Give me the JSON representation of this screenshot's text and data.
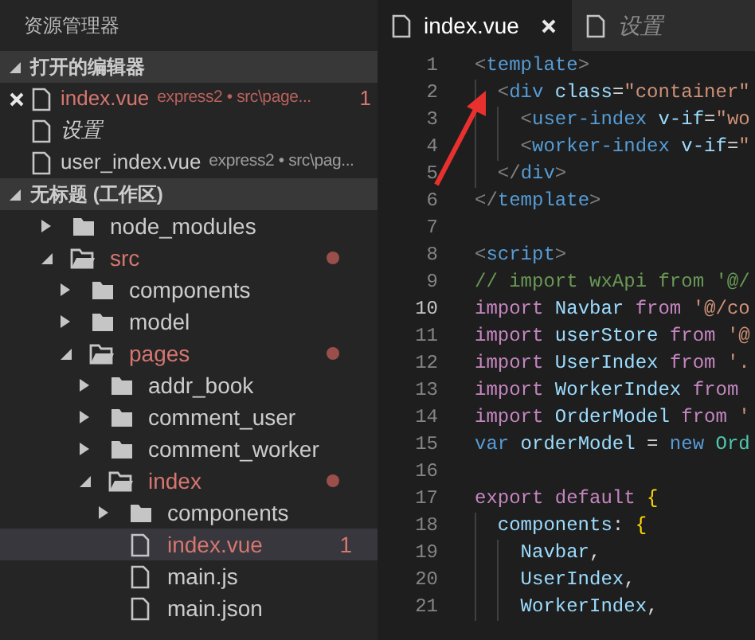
{
  "sidebar": {
    "title": "资源管理器",
    "open_editors": {
      "title": "打开的编辑器",
      "expanded": true,
      "items": [
        {
          "name": "index.vue",
          "description": "express2 • src\\page...",
          "badge": "1",
          "modified": true,
          "italic": false,
          "closable": true
        },
        {
          "name": "设置",
          "italic": true,
          "modified": false,
          "closable": false
        },
        {
          "name": "user_index.vue",
          "description": "express2 • src\\pag...",
          "modified": false,
          "italic": false,
          "closable": false
        }
      ]
    },
    "workspace": {
      "title": "无标题 (工作区)",
      "expanded": true,
      "tree": [
        {
          "name": "node_modules",
          "kind": "folder",
          "expanded": false,
          "modified": false
        },
        {
          "name": "src",
          "kind": "folder",
          "expanded": true,
          "modified": true,
          "children": [
            {
              "name": "components",
              "kind": "folder",
              "expanded": false,
              "modified": false
            },
            {
              "name": "model",
              "kind": "folder",
              "expanded": false,
              "modified": false
            },
            {
              "name": "pages",
              "kind": "folder",
              "expanded": true,
              "modified": true,
              "children": [
                {
                  "name": "addr_book",
                  "kind": "folder",
                  "expanded": false,
                  "modified": false
                },
                {
                  "name": "comment_user",
                  "kind": "folder",
                  "expanded": false,
                  "modified": false
                },
                {
                  "name": "comment_worker",
                  "kind": "folder",
                  "expanded": false,
                  "modified": false
                },
                {
                  "name": "index",
                  "kind": "folder",
                  "expanded": true,
                  "modified": true,
                  "children": [
                    {
                      "name": "components",
                      "kind": "folder",
                      "expanded": false,
                      "modified": false
                    },
                    {
                      "name": "index.vue",
                      "kind": "file",
                      "modified": true,
                      "selected": true,
                      "badge": "1"
                    },
                    {
                      "name": "main.js",
                      "kind": "file",
                      "modified": false,
                      "selected": false
                    },
                    {
                      "name": "main.json",
                      "kind": "file",
                      "modified": false,
                      "selected": false
                    }
                  ]
                }
              ]
            }
          ]
        }
      ]
    }
  },
  "tabs": [
    {
      "label": "index.vue",
      "selected": true,
      "italic": false
    },
    {
      "label": "设置",
      "selected": false,
      "italic": true
    }
  ],
  "code": [
    {
      "number": "1",
      "current": false,
      "tokens": [
        {
          "t": "<",
          "kind": "punct"
        },
        {
          "t": "template",
          "kind": "tag"
        },
        {
          "t": ">",
          "kind": "punct"
        }
      ]
    },
    {
      "number": "2",
      "current": false,
      "tokens": [
        {
          "t": "  <",
          "kind": "punct"
        },
        {
          "t": "div",
          "kind": "tag"
        },
        {
          "t": " class",
          "kind": "attr"
        },
        {
          "t": "=",
          "kind": "plain"
        },
        {
          "t": "\"container\"",
          "kind": "string"
        }
      ]
    },
    {
      "number": "3",
      "current": false,
      "tokens": [
        {
          "t": "    <",
          "kind": "punct"
        },
        {
          "t": "user-index",
          "kind": "tag"
        },
        {
          "t": " v-if",
          "kind": "attr"
        },
        {
          "t": "=",
          "kind": "plain"
        },
        {
          "t": "\"wo",
          "kind": "string"
        }
      ]
    },
    {
      "number": "4",
      "current": false,
      "tokens": [
        {
          "t": "    <",
          "kind": "punct"
        },
        {
          "t": "worker-index",
          "kind": "tag"
        },
        {
          "t": " v-if",
          "kind": "attr"
        },
        {
          "t": "=",
          "kind": "plain"
        },
        {
          "t": "\"",
          "kind": "string"
        }
      ]
    },
    {
      "number": "5",
      "current": false,
      "tokens": [
        {
          "t": "  </",
          "kind": "punct"
        },
        {
          "t": "div",
          "kind": "tag"
        },
        {
          "t": ">",
          "kind": "punct"
        }
      ]
    },
    {
      "number": "6",
      "current": false,
      "tokens": [
        {
          "t": "</",
          "kind": "punct"
        },
        {
          "t": "template",
          "kind": "tag"
        },
        {
          "t": ">",
          "kind": "punct"
        }
      ]
    },
    {
      "number": "7",
      "current": false
    },
    {
      "number": "8",
      "current": false,
      "tokens": [
        {
          "t": "<",
          "kind": "punct"
        },
        {
          "t": "script",
          "kind": "tag"
        },
        {
          "t": ">",
          "kind": "punct"
        }
      ]
    },
    {
      "number": "9",
      "current": false,
      "tokens": [
        {
          "t": "// import wxApi from '@/",
          "kind": "comment"
        }
      ]
    },
    {
      "number": "10",
      "current": true,
      "tokens": [
        {
          "t": "import",
          "kind": "keyword"
        },
        {
          "t": " Navbar ",
          "kind": "ident"
        },
        {
          "t": "from",
          "kind": "keyword"
        },
        {
          "t": " '@/co",
          "kind": "string"
        }
      ]
    },
    {
      "number": "11",
      "current": false,
      "tokens": [
        {
          "t": "import",
          "kind": "keyword"
        },
        {
          "t": " userStore ",
          "kind": "ident"
        },
        {
          "t": "from",
          "kind": "keyword"
        },
        {
          "t": " '@",
          "kind": "string"
        }
      ]
    },
    {
      "number": "12",
      "current": false,
      "tokens": [
        {
          "t": "import",
          "kind": "keyword"
        },
        {
          "t": " UserIndex ",
          "kind": "ident"
        },
        {
          "t": "from",
          "kind": "keyword"
        },
        {
          "t": " '.",
          "kind": "string"
        }
      ]
    },
    {
      "number": "13",
      "current": false,
      "tokens": [
        {
          "t": "import",
          "kind": "keyword"
        },
        {
          "t": " WorkerIndex ",
          "kind": "ident"
        },
        {
          "t": "from",
          "kind": "keyword"
        }
      ]
    },
    {
      "number": "14",
      "current": false,
      "tokens": [
        {
          "t": "import",
          "kind": "keyword"
        },
        {
          "t": " OrderModel ",
          "kind": "ident"
        },
        {
          "t": "from",
          "kind": "keyword"
        },
        {
          "t": " '",
          "kind": "string"
        }
      ]
    },
    {
      "number": "15",
      "current": false,
      "tokens": [
        {
          "t": "var",
          "kind": "storage"
        },
        {
          "t": " orderModel ",
          "kind": "ident"
        },
        {
          "t": "=",
          "kind": "plain"
        },
        {
          "t": " new",
          "kind": "storage"
        },
        {
          "t": " Ord",
          "kind": "class"
        }
      ]
    },
    {
      "number": "16",
      "current": false
    },
    {
      "number": "17",
      "current": false,
      "tokens": [
        {
          "t": "export default",
          "kind": "keyword"
        },
        {
          "t": " {",
          "kind": "brace"
        }
      ]
    },
    {
      "number": "18",
      "current": false,
      "tokens": [
        {
          "t": "  components",
          "kind": "ident"
        },
        {
          "t": ": ",
          "kind": "plain"
        },
        {
          "t": "{",
          "kind": "brace"
        }
      ]
    },
    {
      "number": "19",
      "current": false,
      "tokens": [
        {
          "t": "    Navbar",
          "kind": "ident"
        },
        {
          "t": ",",
          "kind": "plain"
        }
      ]
    },
    {
      "number": "20",
      "current": false,
      "tokens": [
        {
          "t": "    UserIndex",
          "kind": "ident"
        },
        {
          "t": ",",
          "kind": "plain"
        }
      ]
    },
    {
      "number": "21",
      "current": false,
      "tokens": [
        {
          "t": "    WorkerIndex",
          "kind": "ident"
        },
        {
          "t": ",",
          "kind": "plain"
        }
      ]
    }
  ]
}
